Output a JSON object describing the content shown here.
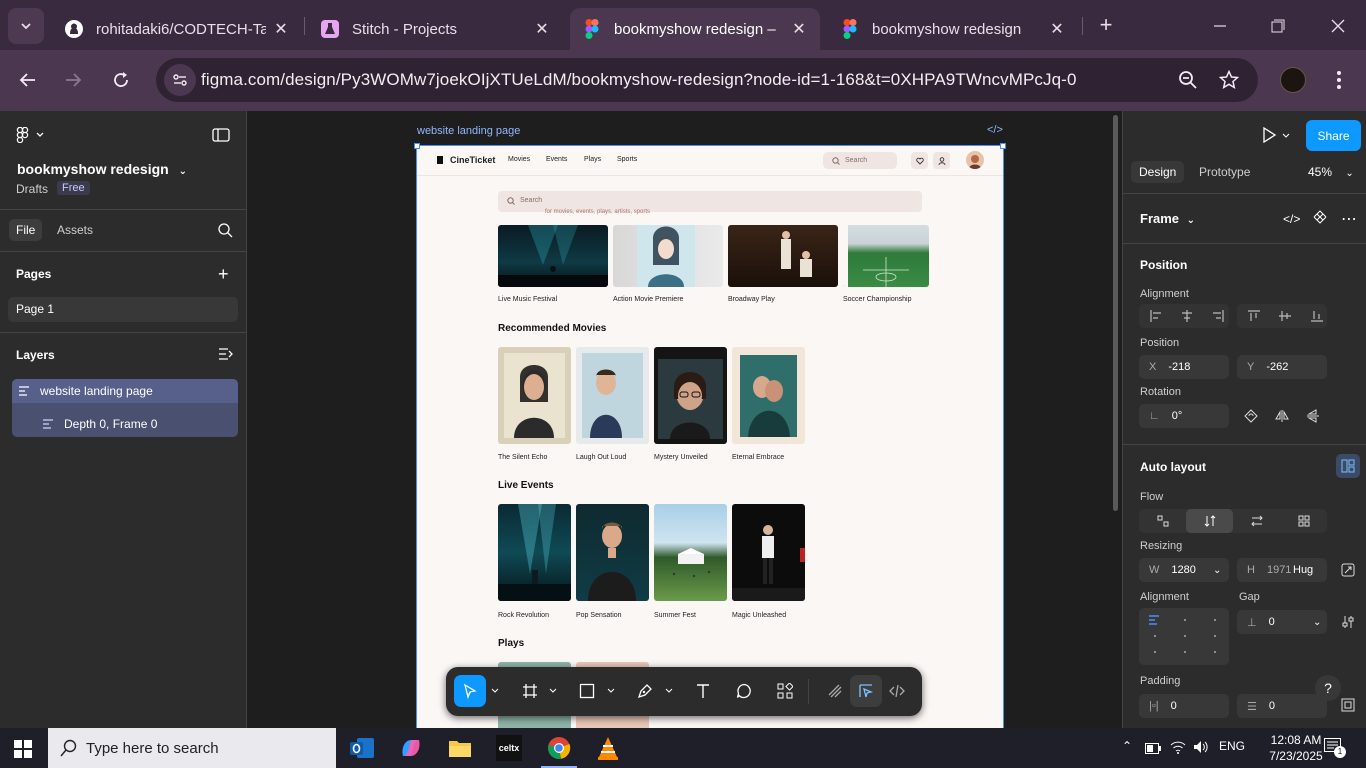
{
  "browser": {
    "tabs": [
      {
        "title": "rohitadaki6/CODTECH-Ta",
        "icon": "github-icon"
      },
      {
        "title": "Stitch - Projects",
        "icon": "flask-icon"
      },
      {
        "title": "bookmyshow redesign – ",
        "icon": "figma-icon",
        "active": true
      },
      {
        "title": "bookmyshow redesign",
        "icon": "figma-icon"
      }
    ],
    "url": "figma.com/design/Py3WOMw7joekOIjXTUeLdM/bookmyshow-redesign?node-id=1-168&t=0XHPA9TWncvMPcJq-0"
  },
  "figma": {
    "project_title": "bookmyshow redesign",
    "drafts_label": "Drafts",
    "plan_badge": "Free",
    "panel_tabs": {
      "file": "File",
      "assets": "Assets"
    },
    "pages_label": "Pages",
    "page_item": "Page 1",
    "layers_label": "Layers",
    "layers": [
      "website landing page",
      "Depth 0, Frame 0"
    ],
    "frame_label": "website landing page",
    "design_tab": "Design",
    "prototype_tab": "Prototype",
    "zoom": "45%",
    "share_label": "Share",
    "frame_type": "Frame",
    "position_head": "Position",
    "alignment_label": "Alignment",
    "position_label": "Position",
    "x_prefix": "X",
    "x_value": "-218",
    "y_prefix": "Y",
    "y_value": "-262",
    "rotation_label": "Rotation",
    "rotation_value": "0°",
    "auto_layout_head": "Auto layout",
    "flow_label": "Flow",
    "resizing_label": "Resizing",
    "w_prefix": "W",
    "w_value": "1280",
    "h_prefix": "H",
    "h_value": "1971",
    "h_mode": "Hug",
    "alignment2_label": "Alignment",
    "gap_label": "Gap",
    "gap_value": "0",
    "padding_label": "Padding",
    "padding_h": "0",
    "padding_v": "0"
  },
  "site": {
    "brand": "CineTicket",
    "nav": [
      "Movies",
      "Events",
      "Plays",
      "Sports"
    ],
    "search_placeholder": "Search",
    "big_search": "Search",
    "chips": "for movies, events, plays, artists, sports",
    "featured": [
      "Live Music Festival",
      "Action Movie Premiere",
      "Broadway Play",
      "Soccer Championship"
    ],
    "recommended_title": "Recommended Movies",
    "movies": [
      "The Silent Echo",
      "Laugh Out Loud",
      "Mystery Unveiled",
      "Eternal Embrace"
    ],
    "live_title": "Live Events",
    "events": [
      "Rock Revolution",
      "Pop Sensation",
      "Summer Fest",
      "Magic Unleashed"
    ],
    "plays_title": "Plays"
  },
  "taskbar": {
    "search_placeholder": "Type here to search",
    "lang": "ENG",
    "time": "12:08 AM",
    "date": "7/23/2025",
    "notifications": "1"
  },
  "colors": {
    "tabbar": "#3a2a3f",
    "toolbar": "#4b3850",
    "figma_panel": "#2c2c2c",
    "canvas": "#1e1e1e",
    "accent": "#0d99ff",
    "selection": "#4a8dff"
  }
}
